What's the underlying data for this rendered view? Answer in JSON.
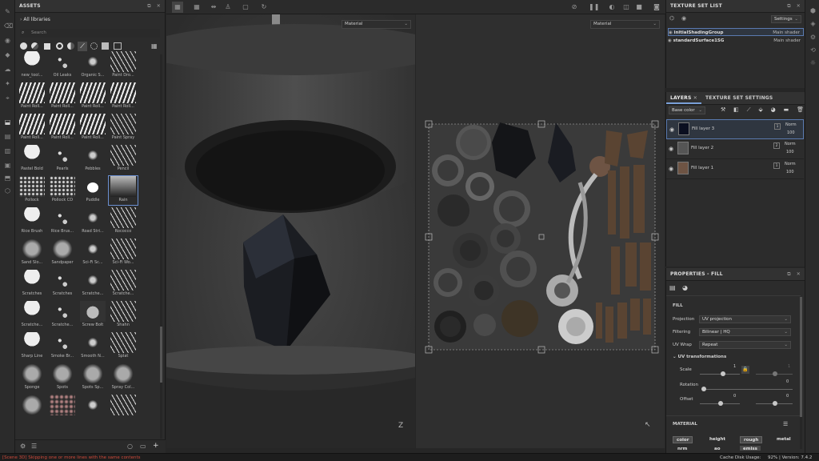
{
  "assets": {
    "title": "ASSETS",
    "breadcrumb": "All libraries",
    "search_placeholder": "Search",
    "items": [
      "new_tool...",
      "Oil Leaks",
      "Organic S...",
      "Paint Dro...",
      "Paint Roll...",
      "Paint Roll...",
      "Paint Roll...",
      "Paint Roll...",
      "Paint Roll...",
      "Paint Roll...",
      "Paint Roll...",
      "Paint Spray",
      "Pastel Bold",
      "Pearls",
      "Pebbles",
      "Pencil",
      "Pollock",
      "Pollock CD",
      "Puddle",
      "Rain",
      "Rice Brush",
      "Rice Brus...",
      "Road Stri...",
      "Rococco",
      "Sand Slo...",
      "Sandpaper",
      "Sci-Fi Sc...",
      "Sci-Fi Wo...",
      "Scratches",
      "Scratches",
      "Scratche...",
      "Scratche...",
      "Scratche...",
      "Scratche...",
      "Screw Bolt",
      "Shahn",
      "Sharp Line",
      "Smoke Br...",
      "Smooth N...",
      "Splat",
      "Sponge",
      "Spots",
      "Spots Sp...",
      "Spray Col...",
      "",
      "",
      "",
      ""
    ]
  },
  "viewport": {
    "left_dropdown": "Material",
    "right_dropdown": "Material",
    "axis_label": "Z"
  },
  "texture_set_list": {
    "title": "TEXTURE SET LIST",
    "settings_label": "Settings",
    "sets": [
      {
        "name": "initialShadingGroup",
        "shader": "Main shader"
      },
      {
        "name": "standardSurface1SG",
        "shader": "Main shader"
      }
    ]
  },
  "layers": {
    "tab_layers": "LAYERS",
    "tab_tss": "TEXTURE SET SETTINGS",
    "channel": "Base color",
    "items": [
      {
        "name": "Fill layer 3",
        "blend": "Norm",
        "opacity": "100",
        "index": "1"
      },
      {
        "name": "Fill layer 2",
        "blend": "Norm",
        "opacity": "100",
        "index": "2"
      },
      {
        "name": "Fill layer 1",
        "blend": "Norm",
        "opacity": "100",
        "index": "1"
      }
    ]
  },
  "properties": {
    "title": "PROPERTIES - FILL",
    "section": "FILL",
    "projection_label": "Projection",
    "projection_value": "UV projection",
    "filtering_label": "Filtering",
    "filtering_value": "Bilinear | HQ",
    "uvwrap_label": "UV Wrap",
    "uvwrap_value": "Repeat",
    "uvt_label": "UV transformations",
    "scale_label": "Scale",
    "scale_value": "1",
    "scale_value2": "1",
    "rotation_label": "Rotation",
    "rotation_value": "0",
    "offset_label": "Offset",
    "offset_value1": "0",
    "offset_value2": "0",
    "material_label": "MATERIAL",
    "channels": [
      "color",
      "height",
      "rough",
      "metal",
      "nrm",
      "ao",
      "emiss"
    ]
  },
  "status": {
    "message": "[Scene 3D] Skipping one or more lines with the same contents",
    "cache": "Cache Disk Usage:",
    "cache_value": "92% | Version: 7.4.2"
  }
}
